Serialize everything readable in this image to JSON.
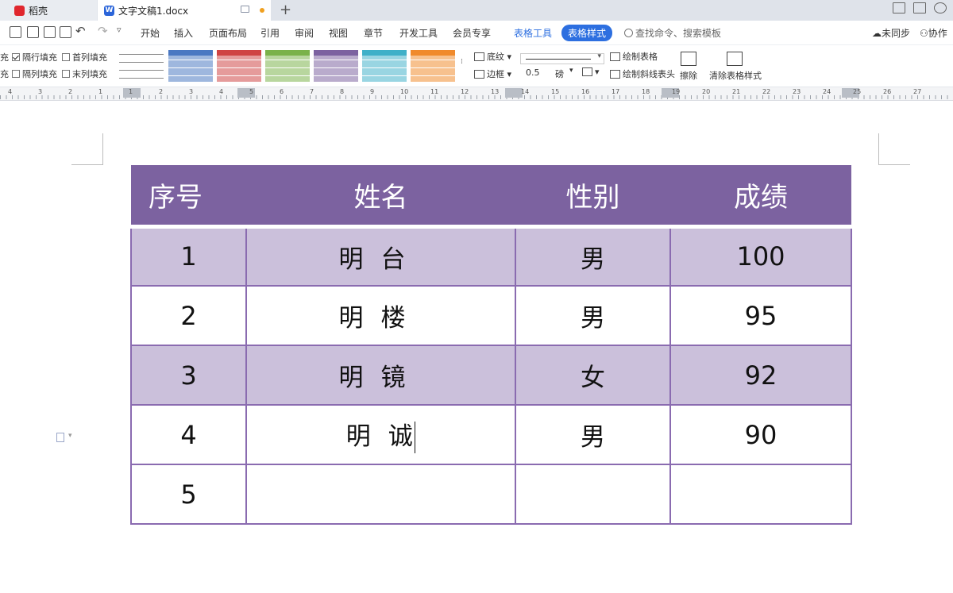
{
  "tabs": [
    {
      "label": "稻壳"
    },
    {
      "label": "文字文稿1.docx"
    }
  ],
  "menu": {
    "items": [
      "开始",
      "插入",
      "页面布局",
      "引用",
      "审阅",
      "视图",
      "章节",
      "开发工具",
      "会员专享"
    ],
    "table_tools": "表格工具",
    "table_style": "表格样式",
    "search_placeholder": "查找命令、搜索模板",
    "sync": "未同步",
    "collab": "协作"
  },
  "ribbon": {
    "fill_label_a": "充",
    "fill_label_b": "充",
    "alt_row_fill": "隔行填充",
    "first_col_fill": "首列填充",
    "alt_col_fill": "隔列填充",
    "last_col_fill": "末列填充",
    "shading": "底纹",
    "border": "边框",
    "line_width": "0.5",
    "line_unit": "磅",
    "draw_table": "绘制表格",
    "draw_diagonal": "绘制斜线表头",
    "erase": "擦除",
    "clear_style": "清除表格样式",
    "swatch_colors": [
      "#4a78c2",
      "#cf4343",
      "#7ab24a",
      "#7c62a0",
      "#3fb0c8",
      "#f08a2c"
    ]
  },
  "ruler": {
    "numbers": [
      "4",
      "3",
      "2",
      "1",
      "1",
      "2",
      "3",
      "4",
      "5",
      "6",
      "7",
      "8",
      "9",
      "10",
      "11",
      "12",
      "13",
      "14",
      "15",
      "16",
      "17",
      "18",
      "19",
      "20",
      "21",
      "22",
      "23",
      "24",
      "25",
      "26",
      "27"
    ]
  },
  "table": {
    "headers": [
      "序号",
      "姓名",
      "性别",
      "成绩"
    ],
    "rows": [
      [
        "1",
        "明台",
        "男",
        "100"
      ],
      [
        "2",
        "明楼",
        "男",
        "95"
      ],
      [
        "3",
        "明镜",
        "女",
        "92"
      ],
      [
        "4",
        "明诚",
        "男",
        "90"
      ],
      [
        "5",
        "",
        "",
        ""
      ]
    ],
    "header_color": "#7c62a0",
    "band_color": "#cbc0db",
    "border_color": "#8a6bb0"
  }
}
